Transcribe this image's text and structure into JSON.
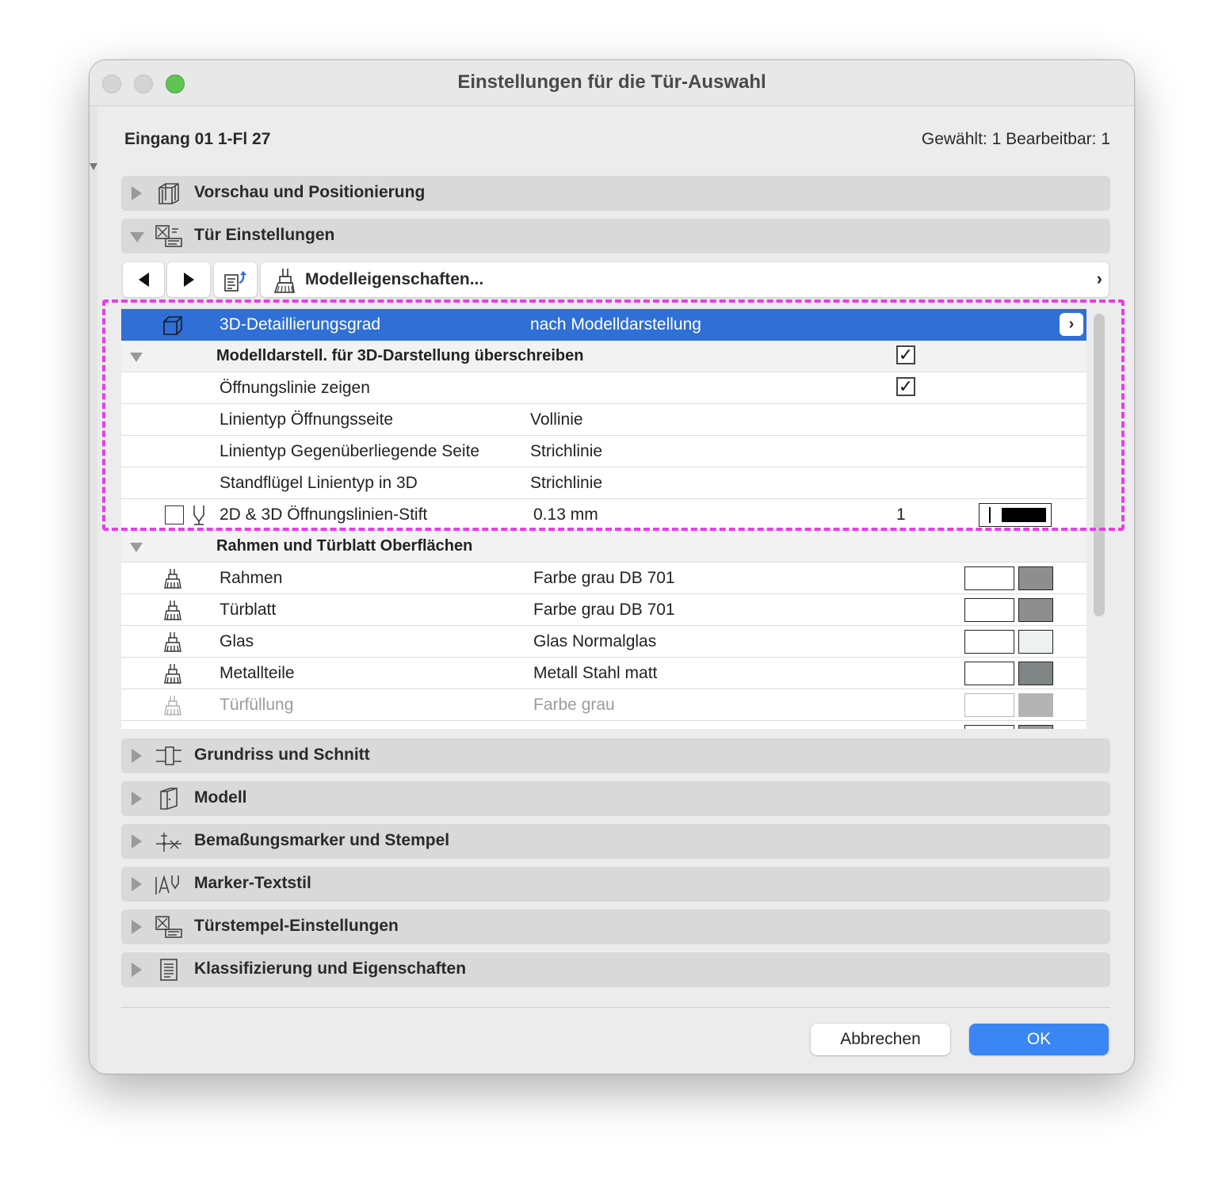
{
  "window": {
    "title": "Einstellungen für die Tür-Auswahl"
  },
  "header": {
    "element_name": "Eingang 01 1-Fl 27",
    "selection_info": "Gewählt: 1 Bearbeitbar: 1"
  },
  "sections": {
    "vorschau": "Vorschau und Positionierung",
    "tuer": "Tür Einstellungen",
    "grundriss": "Grundriss und Schnitt",
    "modell": "Modell",
    "bemassung": "Bemaßungsmarker und Stempel",
    "marker": "Marker-Textstil",
    "tuerstempel": "Türstempel-Einstellungen",
    "klassifizierung": "Klassifizierung und Eigenschaften"
  },
  "toolbar": {
    "model_label": "Modelleigenschaften...",
    "chevron": "›"
  },
  "rows": {
    "detail": {
      "name": "3D-Detaillierungsgrad",
      "value": "nach Modelldarstellung",
      "chevron": "›"
    },
    "override_group": {
      "name": "Modelldarstell. für 3D-Darstellung überschreiben",
      "checked": "✓"
    },
    "oeffnungslinie": {
      "name": "Öffnungslinie zeigen",
      "checked": "✓"
    },
    "linientyp_oeffnung": {
      "name": "Linientyp Öffnungsseite",
      "value": "Vollinie"
    },
    "linientyp_gegen": {
      "name": "Linientyp Gegenüberliegende Seite",
      "value": "Strichlinie"
    },
    "standfluegel": {
      "name": "Standflügel Linientyp in 3D",
      "value": "Strichlinie"
    },
    "stift": {
      "name": "2D & 3D Öffnungslinien-Stift",
      "value": "0.13 mm",
      "number": "1"
    },
    "surfaces_group": {
      "name": "Rahmen und Türblatt Oberflächen"
    },
    "rahmen": {
      "name": "Rahmen",
      "value": "Farbe grau DB 701",
      "color": "#8e8e8e"
    },
    "tuerblatt": {
      "name": "Türblatt",
      "value": "Farbe grau DB 701",
      "color": "#8e8e8e"
    },
    "glas": {
      "name": "Glas",
      "value": "Glas Normalglas",
      "color": "#edf2f0"
    },
    "metallteile": {
      "name": "Metallteile",
      "value": "Metall Stahl matt",
      "color": "#7f8685"
    },
    "tuerfuellung": {
      "name": "Türfüllung",
      "value": "Farbe grau",
      "color": "#b3b3b3"
    }
  },
  "buttons": {
    "cancel": "Abbrechen",
    "ok": "OK"
  },
  "colors": {
    "accent": "#2f6fd6",
    "ok_button": "#3a86f5",
    "highlight": "#e43ee8"
  }
}
